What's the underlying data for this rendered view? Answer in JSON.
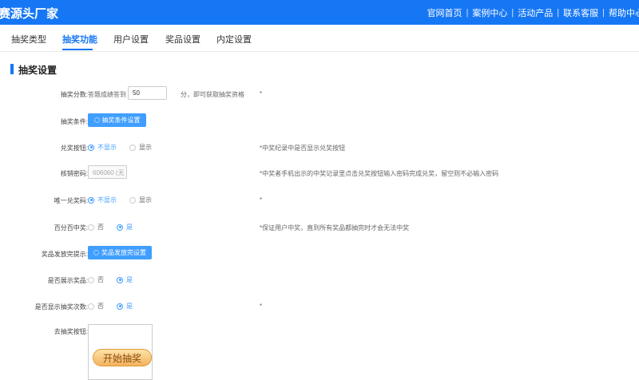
{
  "header": {
    "brand": "赛源头厂家",
    "nav": [
      "官网首页",
      "案例中心",
      "活动产品",
      "联系客服",
      "帮助中心"
    ],
    "separator": "|"
  },
  "tabs": [
    {
      "label": "抽奖类型",
      "active": false
    },
    {
      "label": "抽奖功能",
      "active": true
    },
    {
      "label": "用户设置",
      "active": false
    },
    {
      "label": "奖品设置",
      "active": false
    },
    {
      "label": "内定设置",
      "active": false
    }
  ],
  "section": {
    "title": "抽奖设置"
  },
  "form": {
    "score": {
      "label": "抽奖分数:",
      "prefix": "答题成绩答到",
      "value": "50",
      "suffix": "分，即可获取抽奖资格",
      "hint": "*"
    },
    "condition": {
      "label": "抽奖条件:",
      "button": "抽奖条件设置"
    },
    "redeem_button": {
      "label": "兑奖按钮:",
      "options": [
        "不显示",
        "显示"
      ],
      "selected": "不显示",
      "hint": "*中奖纪录中是否显示兑奖按钮"
    },
    "verify_code": {
      "label": "核销密码:",
      "value": "606060 (无",
      "hint": "*中奖者手机出示的中奖记录里点击兑奖按钮输入密码完成兑奖，留空则不必输入密码"
    },
    "unique_code": {
      "label": "唯一兑奖码:",
      "options": [
        "不显示",
        "显示"
      ],
      "selected": "不显示",
      "hint": "*"
    },
    "guaranteed": {
      "label": "百分百中奖:",
      "options": [
        "否",
        "是"
      ],
      "selected": "是",
      "hint": "*保证用户中奖，直到所有奖品都抽完时才会无法中奖"
    },
    "prize_done_tip": {
      "label": "奖品发放完提示:",
      "button": "奖品发放完设置"
    },
    "show_prizes": {
      "label": "是否展示奖品:",
      "options": [
        "否",
        "是"
      ],
      "selected": "是"
    },
    "show_draw_count": {
      "label": "是否显示抽奖次数:",
      "options": [
        "否",
        "是"
      ],
      "selected": "是",
      "hint": "*"
    },
    "draw_button": {
      "label": "去抽奖按钮:",
      "preview_text": "开始抽奖"
    }
  }
}
